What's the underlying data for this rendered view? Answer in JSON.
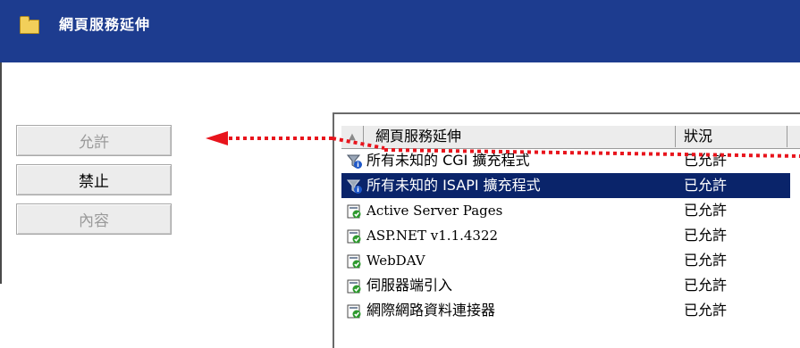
{
  "header": {
    "title": "網頁服務延伸",
    "icon": "folder-icon"
  },
  "buttons": [
    {
      "label": "允許",
      "enabled": false
    },
    {
      "label": "禁止",
      "enabled": true
    },
    {
      "label": "內容",
      "enabled": false
    }
  ],
  "list": {
    "columns": [
      "網頁服務延伸",
      "狀況"
    ],
    "sort_indicator": "▲",
    "rows": [
      {
        "name": "所有未知的 CGI 擴充程式",
        "status": "已允許",
        "icon": "filter-info-icon",
        "selected": false
      },
      {
        "name": "所有未知的 ISAPI 擴充程式",
        "status": "已允許",
        "icon": "filter-info-icon",
        "selected": true
      },
      {
        "name": "Active Server Pages",
        "status": "已允許",
        "icon": "allowed-extension-icon",
        "selected": false
      },
      {
        "name": "ASP.NET v1.1.4322",
        "status": "已允許",
        "icon": "allowed-extension-icon",
        "selected": false
      },
      {
        "name": "WebDAV",
        "status": "已允許",
        "icon": "allowed-extension-icon",
        "selected": false
      },
      {
        "name": "伺服器端引入",
        "status": "已允許",
        "icon": "allowed-extension-icon",
        "selected": false
      },
      {
        "name": "網際網路資料連接器",
        "status": "已允許",
        "icon": "allowed-extension-icon",
        "selected": false
      }
    ]
  },
  "colors": {
    "header_bg": "#1d3c8f",
    "selection": "#0a246a",
    "annotation": "#e8141c"
  }
}
